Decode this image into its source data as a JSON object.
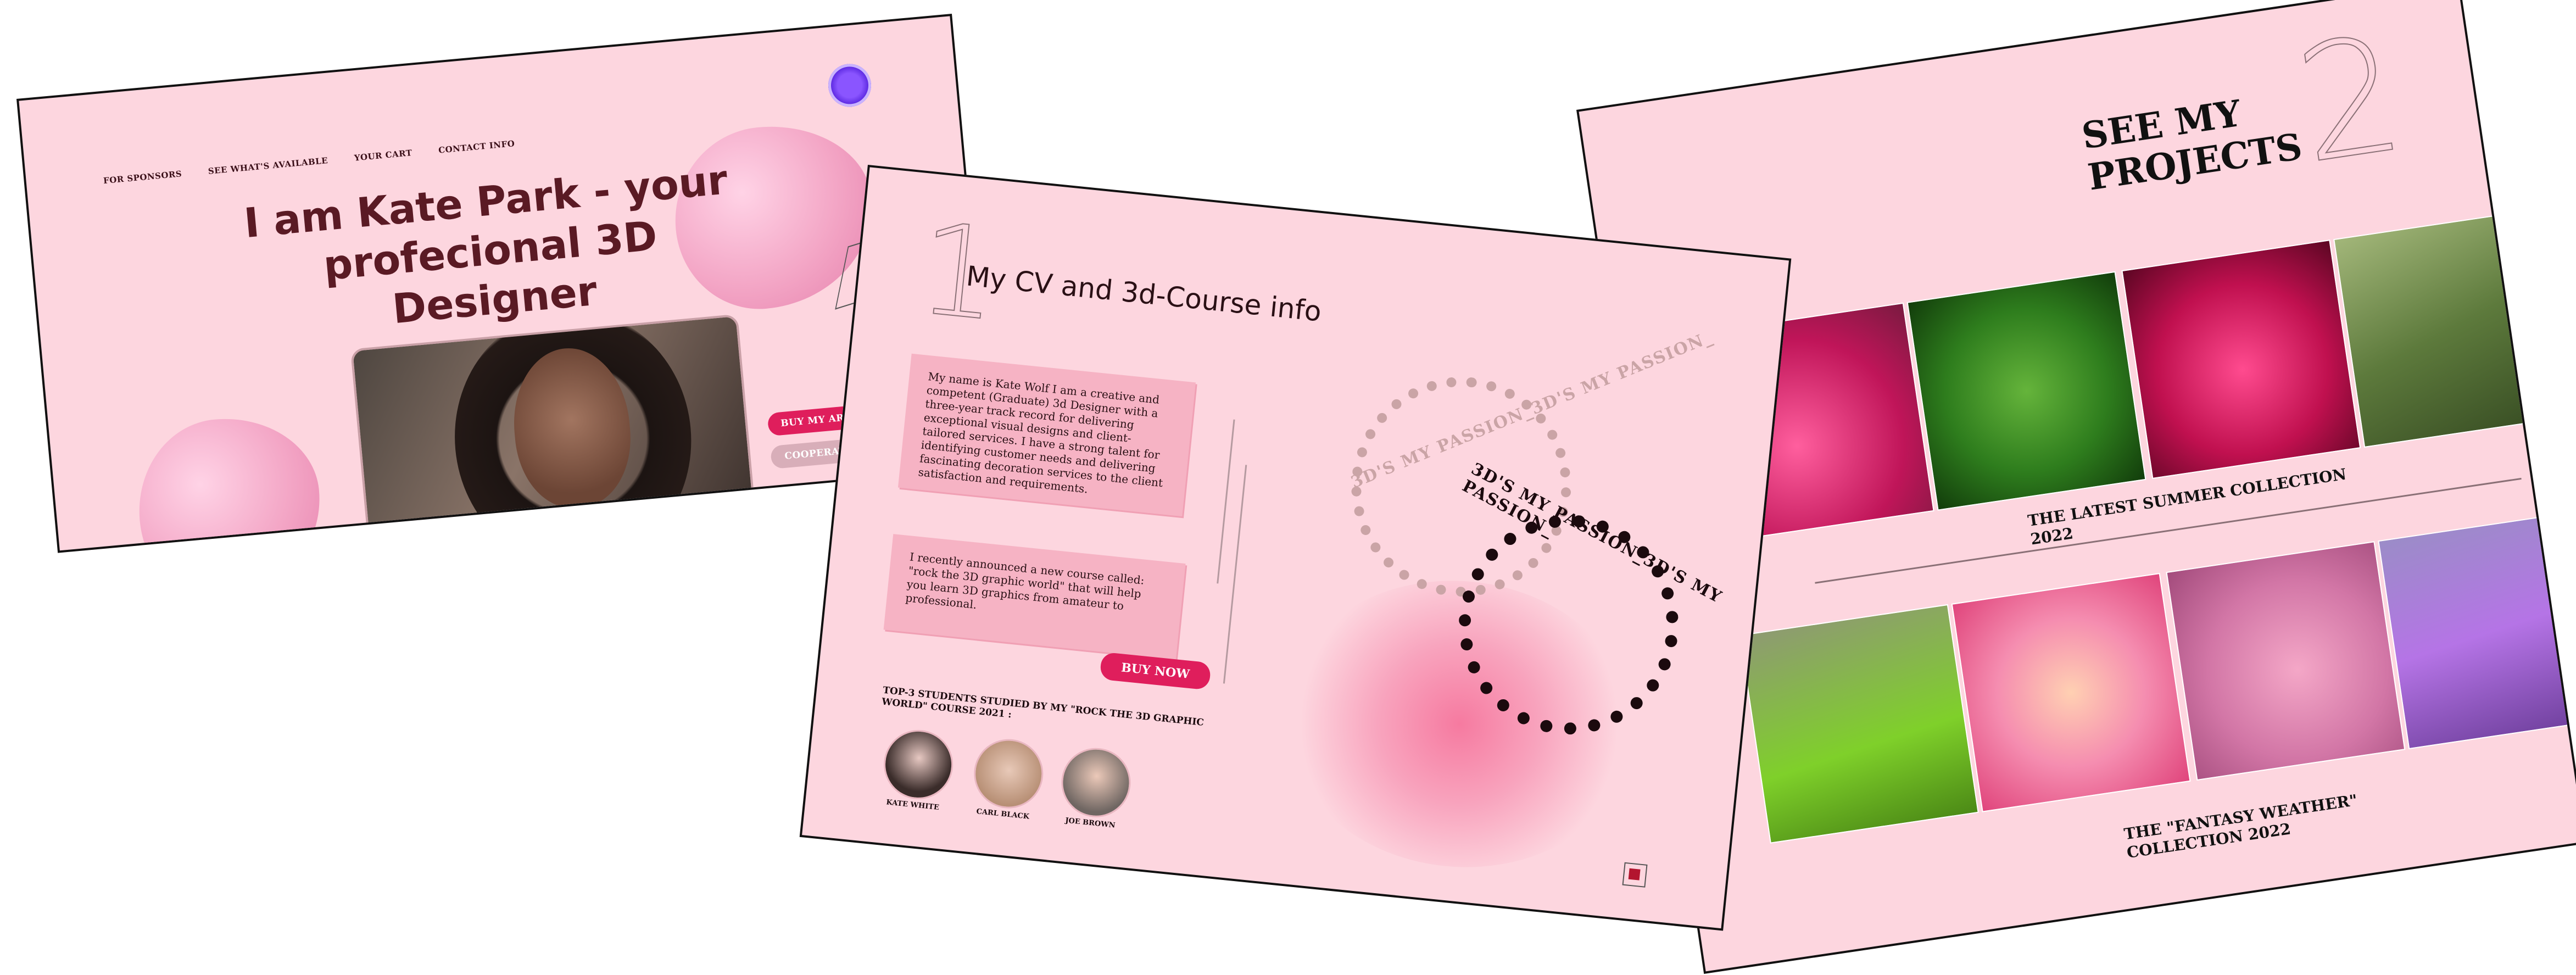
{
  "hero": {
    "nav": [
      "FOR SPONSORS",
      "SEE WHAT'S AVAILABLE",
      "YOUR CART",
      "CONTACT INFO"
    ],
    "title_line1": "I am Kate Park -  your",
    "title_line2": "profecional 3D Designer",
    "buy_button": "BUY MY ART",
    "cooperate_button": "COOPERATE",
    "colors": {
      "background": "#fdd6df",
      "accent": "#df1e5c",
      "title": "#5a1a24"
    }
  },
  "cv": {
    "number": "1",
    "title": "My CV and 3d-Course info",
    "bio": "My name is Kate Wolf I am a creative and competent (Graduate) 3d Designer with a three-year track record for delivering exceptional visual designs and client-tailored services. I have a strong talent for identifying customer needs and delivering fascinating decoration services to the client satisfaction and requirements.",
    "course_text": "I recently announced a new course called: \"rock the 3D graphic world\" that will help you learn 3D graphics from amateur to professional.",
    "buy_now": "BUY NOW",
    "students_title": "TOP-3 STUDENTS STUDIED BY MY \"ROCK THE 3D GRAPHIC WORLD\" COURSE 2021 :",
    "students": [
      "KATE WHITE",
      "CARL BLACK",
      "JOE BROWN"
    ],
    "ring_text": "3D'S MY PASSION_3D'S MY PASSION_"
  },
  "projects": {
    "number": "2",
    "title": "SEE MY PROJECTS",
    "collection1": {
      "line1": "THE LATEST SUMMER COLLECTION",
      "line2": "2022"
    },
    "collection2": {
      "line1": "THE \"FANTASY WEATHER\"",
      "line2": "COLLECTION 2022"
    }
  }
}
